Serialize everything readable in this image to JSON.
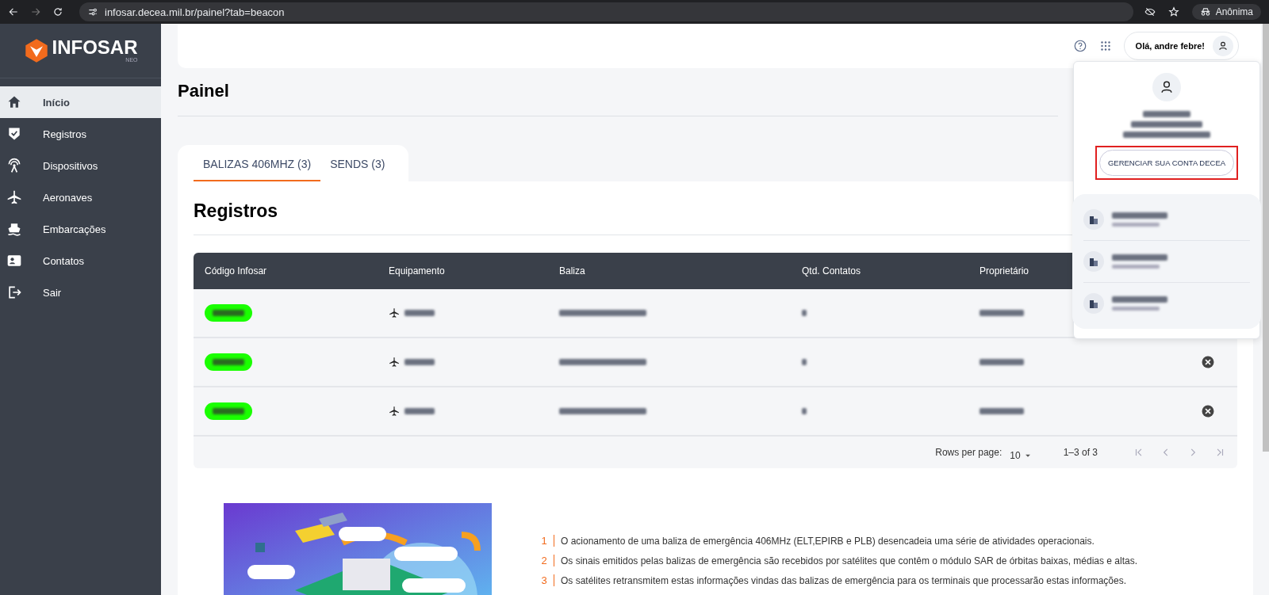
{
  "browser": {
    "url": "infosar.decea.mil.br/painel?tab=beacon",
    "profile": "Anônima"
  },
  "sidebar": {
    "logo": "INFOSAR",
    "logo_sub": "NEO",
    "items": [
      {
        "label": "Início",
        "selected": true
      },
      {
        "label": "Registros",
        "selected": false
      },
      {
        "label": "Dispositivos",
        "selected": false
      },
      {
        "label": "Aeronaves",
        "selected": false
      },
      {
        "label": "Embarcações",
        "selected": false
      },
      {
        "label": "Contatos",
        "selected": false
      },
      {
        "label": "Sair",
        "selected": false
      }
    ]
  },
  "header": {
    "greeting": "Olá, andre febre!"
  },
  "page_title": "Painel",
  "tabs": [
    {
      "label": "BALIZAS 406MHZ (3)",
      "selected": true
    },
    {
      "label": "SENDS (3)",
      "selected": false
    }
  ],
  "section_title": "Registros",
  "table": {
    "columns": [
      "Código Infosar",
      "Equipamento",
      "Baliza",
      "Qtd. Contatos",
      "Proprietário"
    ],
    "rows": [
      {
        "kind": "redacted_under_menu"
      },
      {
        "kind": "redacted"
      },
      {
        "kind": "redacted"
      }
    ]
  },
  "pagination": {
    "rows_per_page_label": "Rows per page:",
    "rows_per_page": "10",
    "range": "1–3 of 3"
  },
  "info": {
    "items": [
      {
        "number": "1",
        "text": "O acionamento de uma baliza de emergência 406MHz (ELT,EPIRB e PLB) desencadeia uma série de atividades operacionais."
      },
      {
        "number": "2",
        "text": "Os sinais emitidos pelas balizas de emergência são recebidos por satélites que contêm o módulo SAR de órbitas baixas, médias e altas."
      },
      {
        "number": "3",
        "text": "Os satélites retransmitem estas informações vindas das balizas de emergência para os terminais que processarão estas informações."
      }
    ]
  },
  "account_menu": {
    "button": "GERENCIAR SUA CONTA DECEA",
    "highlighted": true,
    "organizations": [
      {
        "kind": "redacted"
      },
      {
        "kind": "redacted"
      },
      {
        "kind": "redacted"
      }
    ]
  }
}
